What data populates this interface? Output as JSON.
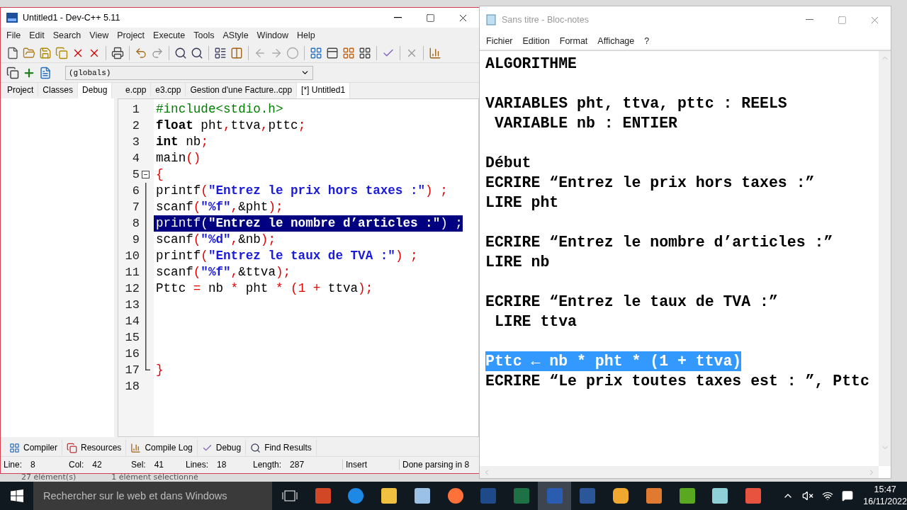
{
  "devcpp": {
    "title": "Untitled1 - Dev-C++ 5.11",
    "menu": [
      "File",
      "Edit",
      "Search",
      "View",
      "Project",
      "Execute",
      "Tools",
      "AStyle",
      "Window",
      "Help"
    ],
    "scope_select": "(globals)",
    "side_tabs": [
      {
        "label": "Project",
        "selected": false
      },
      {
        "label": "Classes",
        "selected": false
      },
      {
        "label": "Debug",
        "selected": true
      }
    ],
    "file_tabs": [
      {
        "label": "e.cpp",
        "selected": false
      },
      {
        "label": "e3.cpp",
        "selected": false
      },
      {
        "label": "Gestion d'une Facture..cpp",
        "selected": false
      },
      {
        "label": "[*] Untitled1",
        "selected": true
      }
    ],
    "code_lines": [
      {
        "number": "1",
        "selected": false,
        "kind": "plain",
        "tokens": [
          {
            "kind": "preproc",
            "text": "#include<stdio.h>"
          }
        ]
      },
      {
        "number": "2",
        "selected": false,
        "kind": "plain",
        "tokens": [
          {
            "kind": "keyword",
            "text": "float"
          },
          {
            "kind": "plain",
            "text": " pht"
          },
          {
            "kind": "symbol",
            "text": ","
          },
          {
            "kind": "plain",
            "text": "ttva"
          },
          {
            "kind": "symbol",
            "text": ","
          },
          {
            "kind": "plain",
            "text": "pttc"
          },
          {
            "kind": "symbol",
            "text": ";"
          }
        ]
      },
      {
        "number": "3",
        "selected": false,
        "kind": "plain",
        "tokens": [
          {
            "kind": "keyword",
            "text": "int"
          },
          {
            "kind": "plain",
            "text": " nb"
          },
          {
            "kind": "symbol",
            "text": ";"
          }
        ]
      },
      {
        "number": "4",
        "selected": false,
        "kind": "plain",
        "tokens": [
          {
            "kind": "plain",
            "text": "main"
          },
          {
            "kind": "symbol",
            "text": "()"
          }
        ]
      },
      {
        "number": "5",
        "selected": false,
        "kind": "fold-start",
        "tokens": [
          {
            "kind": "symbol",
            "text": "{"
          }
        ]
      },
      {
        "number": "6",
        "selected": false,
        "kind": "fold-body",
        "tokens": [
          {
            "kind": "plain",
            "text": "printf"
          },
          {
            "kind": "symbol",
            "text": "("
          },
          {
            "kind": "string",
            "text": "\"Entrez le prix hors taxes :\""
          },
          {
            "kind": "symbol",
            "text": ") ;"
          }
        ]
      },
      {
        "number": "7",
        "selected": false,
        "kind": "fold-body",
        "tokens": [
          {
            "kind": "plain",
            "text": "scanf"
          },
          {
            "kind": "symbol",
            "text": "("
          },
          {
            "kind": "string",
            "text": "\"%f\""
          },
          {
            "kind": "symbol",
            "text": ","
          },
          {
            "kind": "plain",
            "text": "&pht"
          },
          {
            "kind": "symbol",
            "text": ");"
          }
        ]
      },
      {
        "number": "8",
        "selected": true,
        "kind": "fold-body",
        "tokens": [
          {
            "kind": "plain",
            "text": "printf"
          },
          {
            "kind": "symbol",
            "text": "("
          },
          {
            "kind": "string",
            "text": "\"Entrez le nombre d’articles :\""
          },
          {
            "kind": "symbol",
            "text": ") ;"
          }
        ]
      },
      {
        "number": "9",
        "selected": false,
        "kind": "fold-body",
        "tokens": [
          {
            "kind": "plain",
            "text": "scanf"
          },
          {
            "kind": "symbol",
            "text": "("
          },
          {
            "kind": "string",
            "text": "\"%d\""
          },
          {
            "kind": "symbol",
            "text": ","
          },
          {
            "kind": "plain",
            "text": "&nb"
          },
          {
            "kind": "symbol",
            "text": ");"
          }
        ]
      },
      {
        "number": "10",
        "selected": false,
        "kind": "fold-body",
        "tokens": [
          {
            "kind": "plain",
            "text": "printf"
          },
          {
            "kind": "symbol",
            "text": "("
          },
          {
            "kind": "string",
            "text": "\"Entrez le taux de TVA :\""
          },
          {
            "kind": "symbol",
            "text": ") ;"
          }
        ]
      },
      {
        "number": "11",
        "selected": false,
        "kind": "fold-body",
        "tokens": [
          {
            "kind": "plain",
            "text": "scanf"
          },
          {
            "kind": "symbol",
            "text": "("
          },
          {
            "kind": "string",
            "text": "\"%f\""
          },
          {
            "kind": "symbol",
            "text": ","
          },
          {
            "kind": "plain",
            "text": "&ttva"
          },
          {
            "kind": "symbol",
            "text": ");"
          }
        ]
      },
      {
        "number": "12",
        "selected": false,
        "kind": "fold-body",
        "tokens": [
          {
            "kind": "plain",
            "text": "Pttc "
          },
          {
            "kind": "symbol",
            "text": "="
          },
          {
            "kind": "plain",
            "text": " nb "
          },
          {
            "kind": "symbol",
            "text": "*"
          },
          {
            "kind": "plain",
            "text": " pht "
          },
          {
            "kind": "symbol",
            "text": "* (1 + "
          },
          {
            "kind": "plain",
            "text": "ttva"
          },
          {
            "kind": "symbol",
            "text": ");"
          }
        ]
      },
      {
        "number": "13",
        "selected": false,
        "kind": "fold-body"
      },
      {
        "number": "14",
        "selected": false,
        "kind": "fold-body"
      },
      {
        "number": "15",
        "selected": false,
        "kind": "fold-body"
      },
      {
        "number": "16",
        "selected": false,
        "kind": "fold-body"
      },
      {
        "number": "17",
        "selected": false,
        "kind": "fold-end",
        "tokens": [
          {
            "kind": "symbol",
            "text": "}"
          }
        ]
      },
      {
        "number": "18",
        "selected": false,
        "kind": "plain"
      }
    ],
    "bottom_tabs": [
      {
        "kind": "compiler",
        "label": "Compiler"
      },
      {
        "kind": "resources",
        "label": "Resources"
      },
      {
        "kind": "log",
        "label": "Compile Log"
      },
      {
        "kind": "debug",
        "label": "Debug"
      },
      {
        "kind": "find",
        "label": "Find Results"
      }
    ],
    "status": [
      {
        "label": "Line:",
        "value": "8"
      },
      {
        "label": "Col:",
        "value": "42"
      },
      {
        "label": "Sel:",
        "value": "41"
      },
      {
        "label": "Lines:",
        "value": "18"
      },
      {
        "label": "Length:",
        "value": "287"
      },
      {
        "text": "Insert"
      },
      {
        "text": "Done parsing in 8"
      }
    ]
  },
  "notepad": {
    "title": "Sans titre - Bloc-notes",
    "menu": [
      "Fichier",
      "Edition",
      "Format",
      "Affichage",
      "?"
    ],
    "lines": [
      {
        "kind": "text",
        "text": "ALGORITHME",
        "selected": false
      },
      {
        "kind": "blank"
      },
      {
        "kind": "text",
        "text": "VARIABLES pht, ttva, pttc : REELS",
        "selected": false
      },
      {
        "kind": "text",
        "text": " VARIABLE nb : ENTIER",
        "selected": false
      },
      {
        "kind": "blank"
      },
      {
        "kind": "text",
        "text": "Début",
        "selected": false
      },
      {
        "kind": "text",
        "text": "ECRIRE “Entrez le prix hors taxes :”",
        "selected": false
      },
      {
        "kind": "text",
        "text": "LIRE pht",
        "selected": false
      },
      {
        "kind": "blank"
      },
      {
        "kind": "text",
        "text": "ECRIRE “Entrez le nombre d’articles :”",
        "selected": false
      },
      {
        "kind": "text",
        "text": "LIRE nb",
        "selected": false
      },
      {
        "kind": "blank"
      },
      {
        "kind": "text",
        "text": "ECRIRE “Entrez le taux de TVA :”",
        "selected": false
      },
      {
        "kind": "text",
        "text": " LIRE ttva",
        "selected": false
      },
      {
        "kind": "blank"
      },
      {
        "kind": "text",
        "text": "Pttc ← nb * pht * (1 + ttva)",
        "selected": true
      },
      {
        "kind": "text",
        "text": "ECRIRE “Le prix toutes taxes est : ”, Pttc",
        "selected": false
      }
    ]
  },
  "desktop": {
    "explorer_status": [
      "27 élément(s)",
      "1 élément sélectionné"
    ]
  },
  "taskbar": {
    "search_placeholder": "Rechercher sur le web et dans Windows",
    "time": "15:47",
    "date": "16/11/2022"
  }
}
